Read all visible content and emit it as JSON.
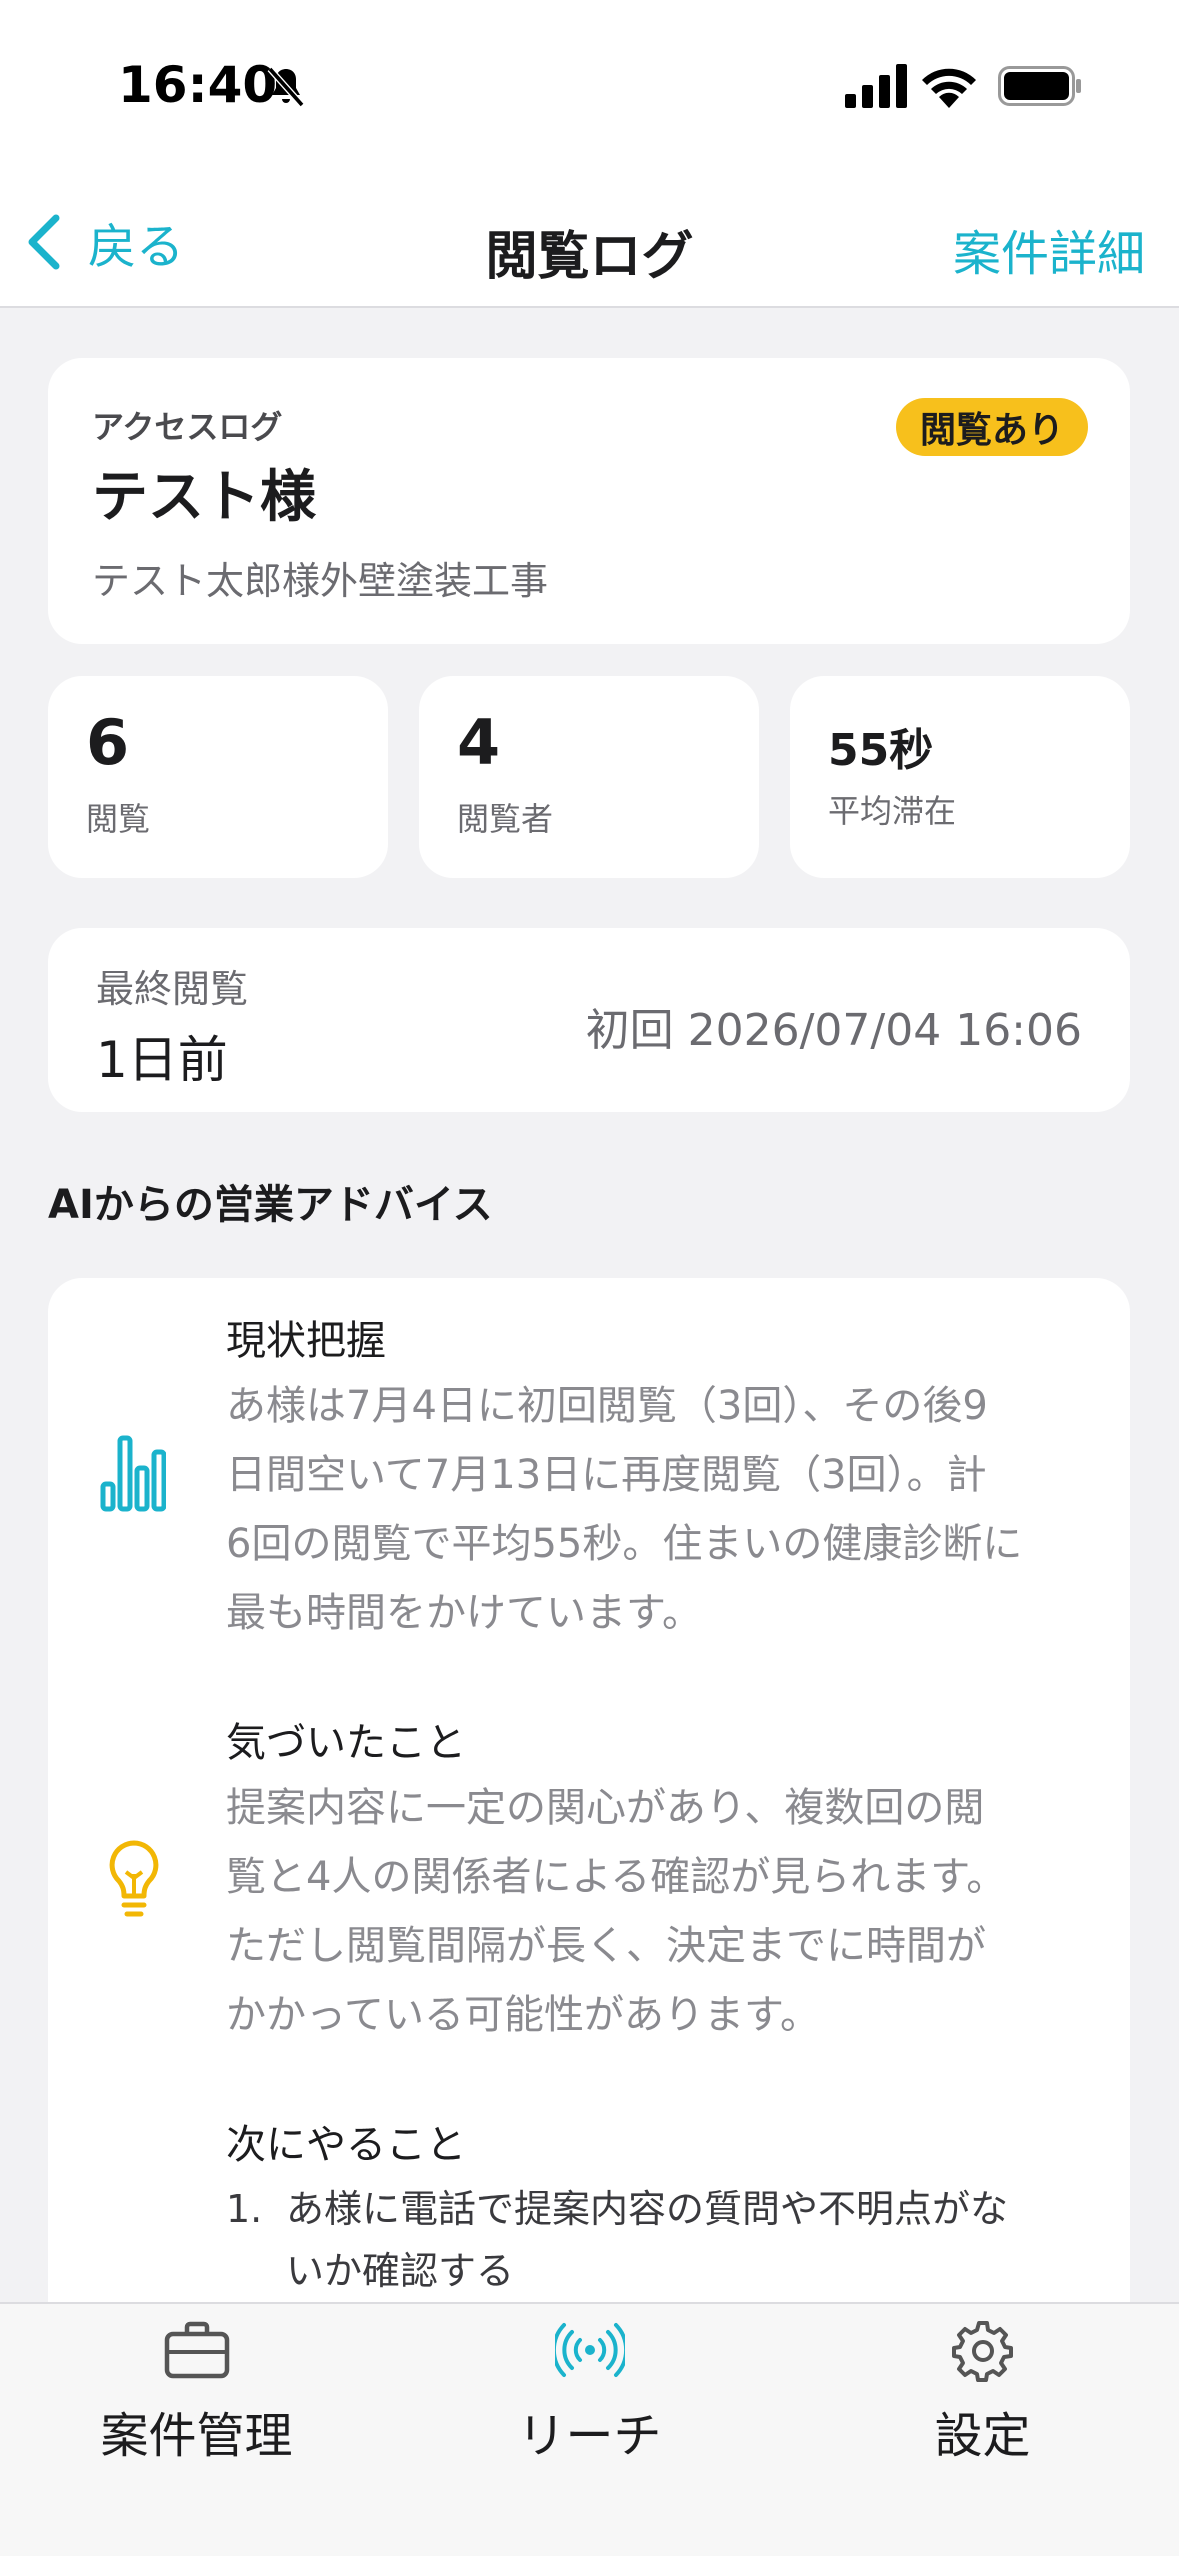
{
  "status_bar": {
    "time": "16:40",
    "icons": [
      "bell-slash-icon",
      "cellular-signal-icon",
      "wifi-icon",
      "battery-icon"
    ]
  },
  "nav": {
    "back_label": "戻る",
    "title": "閲覧ログ",
    "action_label": "案件詳細",
    "accent_color": "#1bb3cc"
  },
  "hero": {
    "label": "アクセスログ",
    "customer_name": "テスト様",
    "project_name": "テスト太郎様外壁塗装工事",
    "badge": "閲覧あり",
    "badge_color": "#f7c01c"
  },
  "stats": [
    {
      "value": "6",
      "label": "閲覧"
    },
    {
      "value": "4",
      "label": "閲覧者"
    },
    {
      "value": "55秒",
      "label": "平均滞在"
    }
  ],
  "last_view": {
    "label": "最終閲覧",
    "value": "1日前",
    "first_view": "初回 2026/07/04 16:06"
  },
  "advice": {
    "section_title": "AIからの営業アドバイス",
    "items": [
      {
        "icon": "bar-chart-icon",
        "heading": "現状把握",
        "lines": [
          "あ様は7月4日に初回閲覧（3回）、その後9",
          "日間空いて7月13日に再度閲覧（3回）。計",
          "6回の閲覧で平均55秒。住まいの健康診断に",
          "最も時間をかけています。"
        ]
      },
      {
        "icon": "lightbulb-icon",
        "heading": "気づいたこと",
        "lines": [
          "提案内容に一定の関心があり、複数回の閲",
          "覧と4人の関係者による確認が見られます。",
          "ただし閲覧間隔が長く、決定までに時間が",
          "かかっている可能性があります。"
        ]
      },
      {
        "heading": "次にやること",
        "steps": [
          {
            "num": "1.",
            "lines": [
              "あ様に電話で提案内容の質問や不明点がな",
              "いか確認する"
            ]
          }
        ]
      }
    ]
  },
  "tab_bar": {
    "tabs": [
      {
        "icon": "briefcase-icon",
        "label": "案件管理"
      },
      {
        "icon": "broadcast-icon",
        "label": "リーチ"
      },
      {
        "icon": "gear-icon",
        "label": "設定"
      }
    ]
  }
}
